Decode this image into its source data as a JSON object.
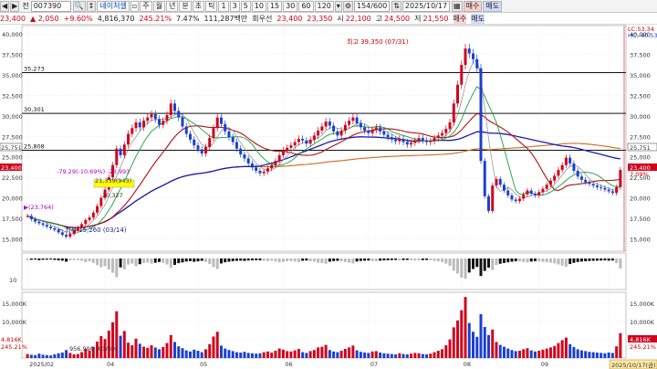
{
  "toolbar": {
    "code": "007390",
    "name_btn": "네이처셀",
    "period_btns": [
      "주",
      "월",
      "년",
      "분",
      "초",
      "틱"
    ],
    "interval_btns": [
      "1",
      "3",
      "5",
      "10",
      "15",
      "30",
      "60",
      "120"
    ],
    "count": "154/600",
    "date": "2025/10/17",
    "buy": "매수",
    "sell": "매도"
  },
  "info": {
    "price": "23,400",
    "change": "▲ 2,050",
    "change_pct": "+9.60%",
    "volume": "4,816,370",
    "volume_ratio": "245.21%",
    "turnover": "7.47%",
    "amount": "111,287백만",
    "rotation": "회우선",
    "ask": "23,400",
    "bid": "23,350",
    "low_label": "시",
    "open": "22,100",
    "high_label": "고",
    "high": "24,500",
    "low_label2": "저",
    "low": "21,550"
  },
  "chart_data": {
    "type": "candlestick",
    "price_axis": {
      "ylim": [
        13500,
        41000
      ],
      "ticks": [
        "40,000",
        "37,500",
        "35,000",
        "32,500",
        "30,000",
        "27,500",
        "25,000",
        "22,500",
        "20,000",
        "17,500",
        "15,000"
      ]
    },
    "x_labels": [
      "2025/02",
      "04",
      "05",
      "06",
      "07",
      "08",
      "09",
      "10"
    ],
    "hlines": [
      {
        "label": "35,273",
        "value": 35273
      },
      {
        "label": "30,301",
        "value": 30301
      },
      {
        "label": "25,808",
        "value": 25808
      }
    ],
    "annotations": {
      "high": "최고 39,350 (07/31)",
      "low": "← 최저 15,260 (03/14)",
      "fib1": "-79.29(-10.69%) -23,993",
      "fib2": "21,339(943)",
      "fib3": "20,327",
      "left_note": "▶(23,764)"
    },
    "right_axis_tags": {
      "lc": "LC:53.34",
      "hc": "HC:-40.53",
      "ma": "25,751",
      "price": "23,400",
      "pct": "7.09%"
    },
    "left_axis_tags": {
      "hline": "25,751",
      "price": "23,400"
    },
    "volume_axis": {
      "ticks": [
        "15,000K",
        "10,000K",
        "5,000K"
      ],
      "tag_price": "4,816K",
      "tag_pct": "245.21%",
      "date_tag": "2025/10/17(금)"
    },
    "volume_note": "956,998 (03/30)",
    "osc_axis": {
      "ticks": [
        "10"
      ]
    },
    "closes": [
      17800,
      17400,
      17100,
      16900,
      16700,
      16500,
      16300,
      16100,
      15800,
      15500,
      15260,
      15600,
      16000,
      16400,
      16800,
      17300,
      17600,
      18200,
      19000,
      20000,
      21000,
      22500,
      24000,
      26000,
      25200,
      26500,
      27800,
      28500,
      29200,
      28600,
      29400,
      29800,
      30200,
      29600,
      28900,
      29400,
      30100,
      31500,
      30600,
      29800,
      28700,
      27800,
      27100,
      26400,
      25900,
      25400,
      26200,
      27300,
      28500,
      29800,
      29000,
      28100,
      27400,
      26800,
      26000,
      25300,
      24800,
      24200,
      23700,
      23300,
      23000,
      23200,
      23600,
      24000,
      24500,
      25200,
      25800,
      26100,
      26400,
      26800,
      27200,
      27000,
      26600,
      27100,
      27600,
      28200,
      28700,
      29300,
      28800,
      28100,
      27600,
      28200,
      28900,
      29400,
      29800,
      29100,
      28600,
      28200,
      27900,
      28300,
      28600,
      28100,
      27700,
      27400,
      27100,
      26900,
      27200,
      26800,
      26500,
      26700,
      27000,
      27300,
      27000,
      26800,
      26900,
      27300,
      27600,
      27900,
      28400,
      29200,
      31500,
      33800,
      36200,
      38200,
      37600,
      36900,
      35800,
      24500,
      20200,
      18400,
      21500,
      22300,
      21600,
      20900,
      20300,
      19800,
      19600,
      19900,
      20400,
      20900,
      20500,
      20300,
      20700,
      21100,
      21600,
      22100,
      22700,
      23400,
      24000,
      24900,
      24200,
      23300,
      22600,
      22200,
      21900,
      21700,
      21500,
      21300,
      21200,
      21000,
      20800,
      20600,
      21300,
      23400
    ],
    "volumes": [
      1.1,
      0.9,
      0.8,
      1.2,
      0.9,
      0.8,
      0.7,
      1.0,
      1.3,
      1.5,
      2.2,
      1.4,
      1.0,
      1.1,
      1.6,
      2.5,
      2.0,
      3.1,
      4.5,
      6.0,
      5.2,
      7.5,
      9.8,
      12.8,
      6.1,
      7.4,
      4.2,
      3.5,
      5.3,
      3.9,
      3.1,
      2.8,
      3.5,
      2.9,
      2.4,
      3.0,
      4.1,
      6.3,
      4.4,
      3.2,
      2.7,
      2.1,
      1.8,
      2.3,
      2.0,
      1.6,
      2.4,
      3.8,
      5.9,
      7.2,
      3.4,
      2.6,
      2.2,
      1.9,
      1.6,
      1.5,
      1.7,
      1.4,
      1.3,
      1.2,
      1.3,
      1.6,
      1.8,
      1.5,
      2.0,
      2.6,
      2.3,
      1.9,
      1.8,
      2.1,
      2.5,
      1.6,
      1.4,
      1.9,
      2.2,
      2.9,
      3.1,
      3.6,
      2.2,
      1.8,
      1.6,
      2.0,
      2.5,
      2.9,
      3.4,
      2.1,
      1.7,
      1.5,
      1.4,
      1.8,
      1.9,
      1.5,
      1.3,
      1.2,
      1.1,
      1.0,
      1.3,
      1.1,
      1.0,
      1.2,
      1.4,
      1.3,
      1.1,
      1.0,
      1.2,
      1.6,
      2.0,
      2.4,
      3.5,
      5.1,
      8.4,
      10.3,
      13.1,
      16.7,
      9.6,
      7.2,
      5.8,
      12.0,
      8.5,
      6.3,
      7.8,
      4.4,
      3.6,
      3.1,
      2.6,
      2.2,
      1.9,
      2.0,
      2.4,
      2.7,
      2.1,
      1.8,
      2.0,
      2.3,
      2.6,
      2.9,
      3.3,
      4.1,
      4.9,
      5.6,
      3.8,
      3.0,
      2.4,
      2.1,
      1.9,
      1.7,
      1.6,
      1.5,
      1.4,
      1.3,
      1.5,
      1.4,
      3.2,
      6.8
    ]
  }
}
